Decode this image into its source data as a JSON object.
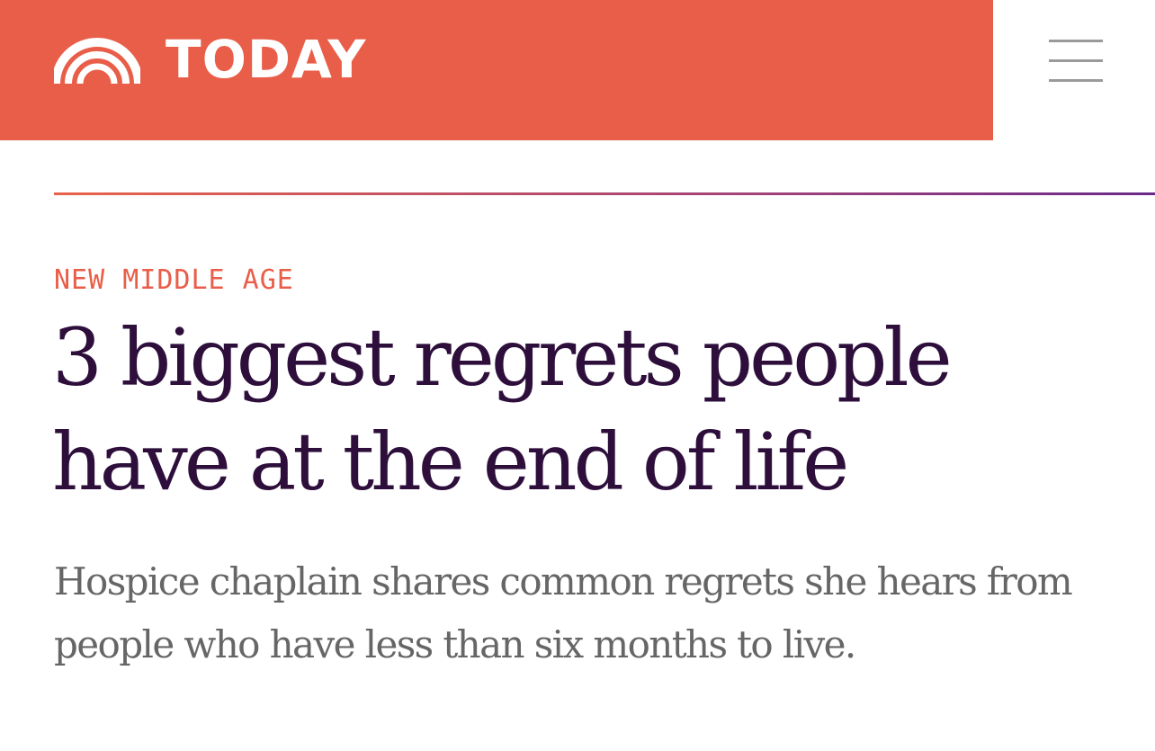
{
  "header": {
    "brand_name": "TODAY",
    "logo_icon": "rainbow-logo-icon",
    "menu_icon": "hamburger-menu-icon",
    "background_color": "#e95e48"
  },
  "article": {
    "section_label": "NEW MIDDLE AGE",
    "headline": "3 biggest regrets people have at the end of life",
    "dek": "Hospice chaplain shares common regrets she hears from people who have less than six months to live.",
    "headline_color": "#2e0f3c",
    "section_color": "#e95e48",
    "dek_color": "#666666"
  }
}
